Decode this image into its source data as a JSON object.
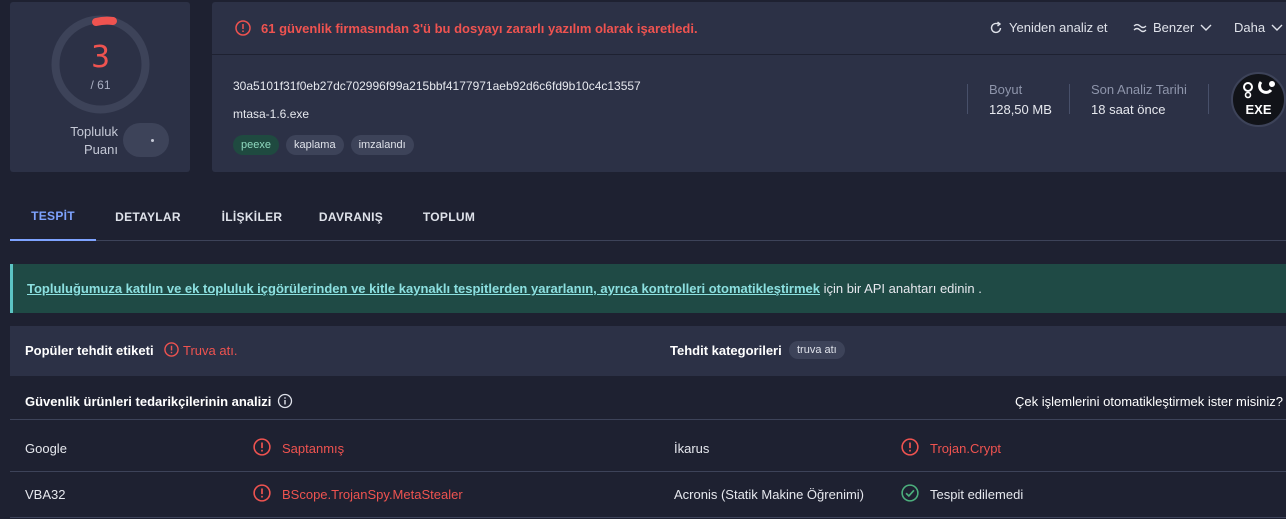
{
  "score": {
    "detected": "3",
    "total": "/ 61",
    "community_label": "Topluluk Puanı",
    "community_value": "-"
  },
  "alert": {
    "text": "61 güvenlik firmasından 3'ü bu dosyayı zararlı yazılım olarak işaretledi."
  },
  "actions": {
    "reanalyze": "Yeniden analiz et",
    "similar": "Benzer",
    "more": "Daha"
  },
  "file": {
    "hash": "30a5101f31f0eb27dc702996f99a215bbf4177971aeb92d6c6fd9b10c4c13557",
    "name": "mtasa-1.6.exe",
    "tags": [
      "peexe",
      "kaplama",
      "imzalandı"
    ],
    "size_label": "Boyut",
    "size_value": "128,50 MB",
    "last_analysis_label": "Son Analiz Tarihi",
    "last_analysis_value": "18 saat önce",
    "type_badge": "EXE"
  },
  "tabs": [
    "TESPİT",
    "DETAYLAR",
    "İLİŞKİLER",
    "DAVRANIŞ",
    "TOPLUM"
  ],
  "banner": {
    "link": "Topluluğumuza katılın ve ek topluluk içgörülerinden ve kitle kaynaklı tespitlerden yararlanın, ayrıca kontrolleri otomatikleştirmek",
    "text": " için bir API anahtarı edinin ."
  },
  "threat": {
    "popular_label": "Popüler tehdit etiketi",
    "popular_value": "Truva atı.",
    "categories_label": "Tehdit kategorileri",
    "category_chip": "truva atı"
  },
  "vendors": {
    "title": "Güvenlik ürünleri tedarikçilerinin analizi",
    "automate": "Çek işlemlerini otomatikleştirmek ister misiniz?",
    "rows": [
      {
        "left_name": "Google",
        "left_result": "Saptanmış",
        "right_name": "İkarus",
        "right_result": "Trojan.Crypt"
      },
      {
        "left_name": "VBA32",
        "left_result": "BScope.TrojanSpy.MetaStealer",
        "right_name": "Acronis (Statik Makine Öğrenimi)",
        "right_result": "Tespit edilemedi"
      }
    ]
  },
  "colors": {
    "malicious": "#ef5350",
    "clean": "#4caf7d",
    "accent": "#7ea3ff",
    "panel": "#2c3146",
    "background": "#1e2131"
  }
}
